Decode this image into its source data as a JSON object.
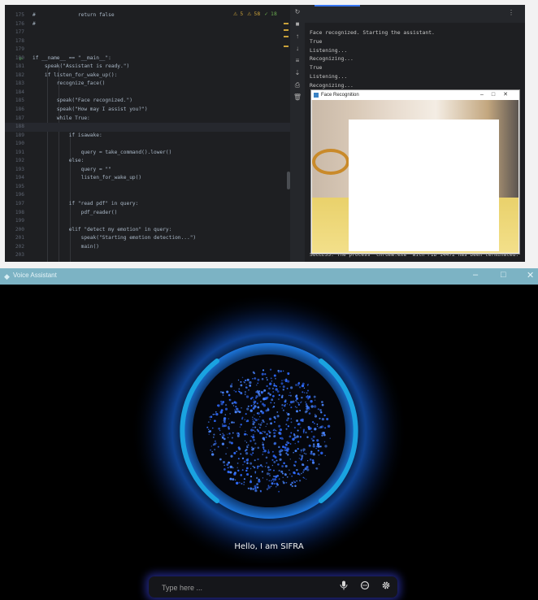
{
  "editor": {
    "lines": [
      {
        "num": "175",
        "text": "#              return false"
      },
      {
        "num": "176",
        "text": "#"
      },
      {
        "num": "177",
        "text": ""
      },
      {
        "num": "178",
        "text": ""
      },
      {
        "num": "179",
        "text": ""
      },
      {
        "num": "180",
        "text": "if __name__ == \"__main__\":"
      },
      {
        "num": "181",
        "text": "    speak(\"Assistant is ready.\")"
      },
      {
        "num": "182",
        "text": "    if listen_for_wake_up():"
      },
      {
        "num": "183",
        "text": "        recognize_face()"
      },
      {
        "num": "184",
        "text": ""
      },
      {
        "num": "185",
        "text": "        speak(\"Face recognized.\")"
      },
      {
        "num": "186",
        "text": "        speak(\"How may I assist you?\")"
      },
      {
        "num": "187",
        "text": "        while True:"
      },
      {
        "num": "188",
        "text": ""
      },
      {
        "num": "189",
        "text": "            if isawake:"
      },
      {
        "num": "190",
        "text": ""
      },
      {
        "num": "191",
        "text": "                query = take_command().lower()"
      },
      {
        "num": "192",
        "text": "            else:"
      },
      {
        "num": "193",
        "text": "                query = \"\""
      },
      {
        "num": "194",
        "text": "                listen_for_wake_up()"
      },
      {
        "num": "195",
        "text": ""
      },
      {
        "num": "196",
        "text": ""
      },
      {
        "num": "197",
        "text": "            if \"read pdf\" in query:"
      },
      {
        "num": "198",
        "text": "                pdf_reader()"
      },
      {
        "num": "199",
        "text": ""
      },
      {
        "num": "200",
        "text": "            elif \"detect my emotion\" in query:"
      },
      {
        "num": "201",
        "text": "                speak(\"Starting emotion detection...\")"
      },
      {
        "num": "202",
        "text": "                main()"
      },
      {
        "num": "203",
        "text": ""
      }
    ],
    "warnings": {
      "warn": "5",
      "weak": "58",
      "ok": "18"
    }
  },
  "console": {
    "lines": [
      "Face recognized. Starting the assistant.",
      "True",
      "Listening...",
      "Recognizing...",
      "True",
      "Listening...",
      "Recognizing..."
    ],
    "success_line": "SUCCESS: The process \"chrome.exe\" with PID 14472 has been terminated."
  },
  "face_window": {
    "title": "Face Recognition"
  },
  "voice_assistant": {
    "window_title": "Voice Assistant",
    "greeting": "Hello, I am SIFRA",
    "input_placeholder": "Type here ...",
    "icons": [
      "microphone-icon",
      "chat-icon",
      "settings-icon"
    ]
  },
  "colors": {
    "accent": "#1aa3e0",
    "glow": "#1b6fff",
    "input_glow": "#3c46e6"
  }
}
